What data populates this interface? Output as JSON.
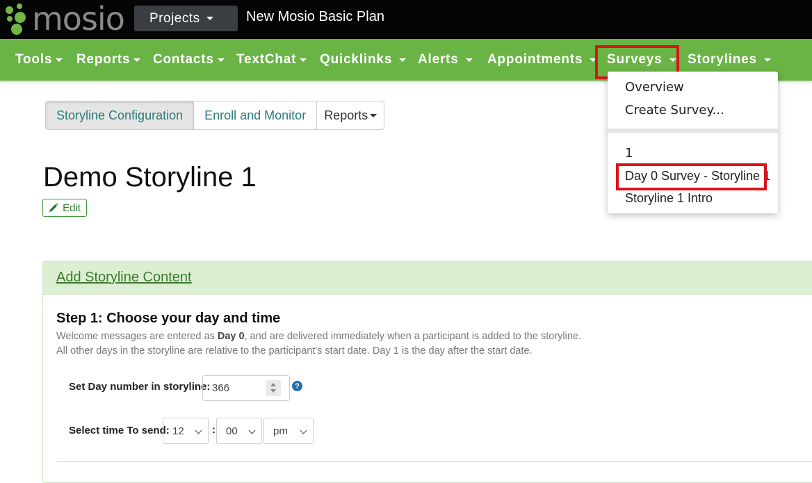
{
  "app": {
    "logo_text": "mosio",
    "projects_label": "Projects",
    "plan_title": "New Mosio Basic Plan"
  },
  "nav": {
    "items": [
      {
        "label": "Tools"
      },
      {
        "label": "Reports"
      },
      {
        "label": "Contacts"
      },
      {
        "label": "TextChat"
      },
      {
        "label": "Quicklinks"
      },
      {
        "label": "Alerts"
      },
      {
        "label": "Appointments"
      },
      {
        "label": "Surveys"
      },
      {
        "label": "Storylines"
      }
    ]
  },
  "surveys_menu": {
    "items": [
      {
        "label": "Overview"
      },
      {
        "label": "Create Survey..."
      },
      {
        "label": "1"
      },
      {
        "label": "Day 0 Survey - Storyline 1"
      },
      {
        "label": "Storyline 1 Intro"
      }
    ]
  },
  "tabs": [
    {
      "label": "Storyline Configuration"
    },
    {
      "label": "Enroll and Monitor"
    },
    {
      "label": "Reports"
    }
  ],
  "page": {
    "title": "Demo Storyline 1",
    "edit_label": "Edit"
  },
  "panel": {
    "header_link": "Add Storyline Content",
    "step_title": "Step 1: Choose your day and time",
    "desc_line1_pre": "Welcome messages are entered as ",
    "desc_line1_bold": "Day 0",
    "desc_line1_post": ", and are delivered immediately when a participant is added to the storyline.",
    "desc_line2": "All other days in the storyline are relative to the participant's start date. Day 1 is the day after the start date.",
    "day_label": "Set Day number in storyline:",
    "day_value": "366",
    "time_label": "Select time To send:",
    "hour": "12",
    "minute": "00",
    "ampm": "pm",
    "colon": ":"
  },
  "colors": {
    "nav_green": "#6ab445",
    "highlight_red": "#d9141a",
    "topbar_black": "#050505"
  }
}
